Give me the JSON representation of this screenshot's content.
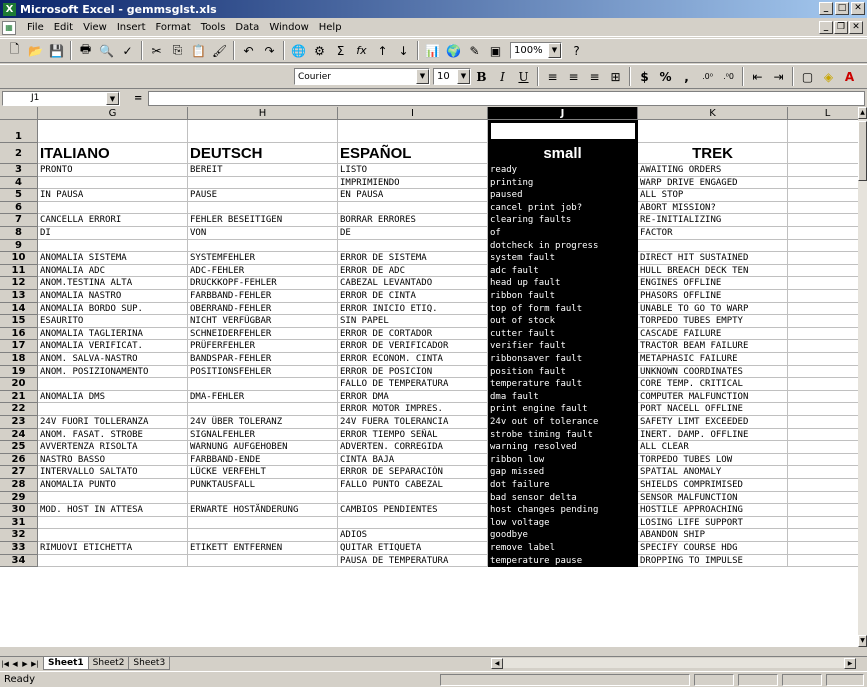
{
  "window": {
    "title": "Microsoft Excel - gemmsglst.xls",
    "app_icon": "excel-icon"
  },
  "menu": [
    "File",
    "Edit",
    "View",
    "Insert",
    "Format",
    "Tools",
    "Data",
    "Window",
    "Help"
  ],
  "toolbar": {
    "zoom": "100%",
    "font": "Courier",
    "font_size": "10",
    "bold": "B",
    "italic": "I",
    "underline": "U",
    "currency": "$",
    "percent": "%",
    "comma": ",",
    "sum": "Σ",
    "fx": "fx"
  },
  "formula_bar": {
    "name_box": "J1",
    "equals": "=",
    "value": ""
  },
  "columns": [
    {
      "letter": "G",
      "selected": false
    },
    {
      "letter": "H",
      "selected": false
    },
    {
      "letter": "I",
      "selected": false
    },
    {
      "letter": "J",
      "selected": true
    },
    {
      "letter": "K",
      "selected": false
    },
    {
      "letter": "L",
      "selected": false
    }
  ],
  "rows": [
    {
      "n": "1",
      "g": "",
      "h": "",
      "i": "",
      "j": "",
      "k": ""
    },
    {
      "n": "2",
      "g": "ITALIANO",
      "h": "DEUTSCH",
      "i": "ESPAÑOL",
      "j": "small",
      "k": "TREK"
    },
    {
      "n": "3",
      "g": "PRONTO",
      "h": "BEREIT",
      "i": "LISTO",
      "j": "ready",
      "k": "AWAITING ORDERS"
    },
    {
      "n": "4",
      "g": "",
      "h": "",
      "i": "IMPRIMIENDO",
      "j": "printing",
      "k": "WARP DRIVE ENGAGED"
    },
    {
      "n": "5",
      "g": "IN PAUSA",
      "h": "PAUSE",
      "i": "EN PAUSA",
      "j": "paused",
      "k": "ALL STOP"
    },
    {
      "n": "6",
      "g": "",
      "h": "",
      "i": "",
      "j": "cancel print job?",
      "k": "ABORT MISSION?"
    },
    {
      "n": "7",
      "g": "CANCELLA ERRORI",
      "h": "FEHLER BESEITIGEN",
      "i": "BORRAR ERRORES",
      "j": "clearing faults",
      "k": "RE-INITIALIZING"
    },
    {
      "n": "8",
      "g": "DI",
      "h": "VON",
      "i": "DE",
      "j": "of",
      "k": "FACTOR"
    },
    {
      "n": "9",
      "g": "",
      "h": "",
      "i": "",
      "j": "dotcheck in progress",
      "k": ""
    },
    {
      "n": "10",
      "g": "ANOMALIA SISTEMA",
      "h": "SYSTEMFEHLER",
      "i": "ERROR DE SISTEMA",
      "j": "system fault",
      "k": "DIRECT HIT SUSTAINED"
    },
    {
      "n": "11",
      "g": "ANOMALIA ADC",
      "h": "ADC-FEHLER",
      "i": "ERROR DE ADC",
      "j": "adc fault",
      "k": "HULL BREACH DECK TEN"
    },
    {
      "n": "12",
      "g": "ANOM.TESTINA ALTA",
      "h": "DRUCKKOPF-FEHLER",
      "i": "CABEZAL LEVANTADO",
      "j": "head up fault",
      "k": "ENGINES OFFLINE"
    },
    {
      "n": "13",
      "g": "ANOMALIA NASTRO",
      "h": "FARBBAND-FEHLER",
      "i": "ERROR DE CINTA",
      "j": "ribbon fault",
      "k": "PHASORS OFFLINE"
    },
    {
      "n": "14",
      "g": "ANOMALIA BORDO SUP.",
      "h": "OBERRAND-FEHLER",
      "i": "ERROR INICIO ETIQ.",
      "j": "top of form fault",
      "k": "UNABLE TO GO TO WARP"
    },
    {
      "n": "15",
      "g": "ESAURITO",
      "h": "NICHT VERFÜGBAR",
      "i": "SIN PAPEL",
      "j": "out of stock",
      "k": "TORPEDO TUBES EMPTY"
    },
    {
      "n": "16",
      "g": "ANOMALIA TAGLIERINA",
      "h": "SCHNEIDERFEHLER",
      "i": "ERROR DE CORTADOR",
      "j": "cutter fault",
      "k": "CASCADE FAILURE"
    },
    {
      "n": "17",
      "g": "ANOMALIA VERIFICAT.",
      "h": "PRÜFERFEHLER",
      "i": "ERROR DE VERIFICADOR",
      "j": "verifier fault",
      "k": "TRACTOR BEAM FAILURE"
    },
    {
      "n": "18",
      "g": "ANOM. SALVA-NASTRO",
      "h": "BANDSPAR-FEHLER",
      "i": "ERROR ECONOM. CINTA",
      "j": "ribbonsaver fault",
      "k": "METAPHASIC FAILURE"
    },
    {
      "n": "19",
      "g": "ANOM. POSIZIONAMENTO",
      "h": "POSITIONSFEHLER",
      "i": "ERROR DE POSICION",
      "j": "position fault",
      "k": "UNKNOWN COORDINATES"
    },
    {
      "n": "20",
      "g": "",
      "h": "",
      "i": "FALLO DE TEMPERATURA",
      "j": "temperature fault",
      "k": "CORE TEMP. CRITICAL"
    },
    {
      "n": "21",
      "g": "ANOMALIA DMS",
      "h": "DMA-FEHLER",
      "i": "ERROR DMA",
      "j": "dma fault",
      "k": "COMPUTER MALFUNCTION"
    },
    {
      "n": "22",
      "g": "",
      "h": "",
      "i": "ERROR MOTOR IMPRES.",
      "j": "print engine fault",
      "k": "PORT NACELL OFFLINE"
    },
    {
      "n": "23",
      "g": "24V FUORI TOLLERANZA",
      "h": "24V ÜBER TOLERANZ",
      "i": "24V FUERA TOLERANCIA",
      "j": "24v out of tolerance",
      "k": "SAFETY LIMT EXCEEDED"
    },
    {
      "n": "24",
      "g": "ANOM. FASAT. STROBE",
      "h": "SIGNALFEHLER",
      "i": "ERROR TIEMPO SEÑAL",
      "j": "strobe timing fault",
      "k": "INERT. DAMP. OFFLINE"
    },
    {
      "n": "25",
      "g": "AVVERTENZA RISOLTA",
      "h": "WARNUNG AUFGEHOBEN",
      "i": "ADVERTEN. CORREGIDA",
      "j": "warning resolved",
      "k": "ALL CLEAR"
    },
    {
      "n": "26",
      "g": "NASTRO BASSO",
      "h": "FARBBAND-ENDE",
      "i": "CINTA BAJA",
      "j": "ribbon low",
      "k": "TORPEDO TUBES LOW"
    },
    {
      "n": "27",
      "g": "INTERVALLO SALTATO",
      "h": "LÜCKE VERFEHLT",
      "i": "ERROR DE SEPARACIÓN",
      "j": "gap missed",
      "k": "SPATIAL ANOMALY"
    },
    {
      "n": "28",
      "g": "ANOMALIA PUNTO",
      "h": "PUNKTAUSFALL",
      "i": "FALLO PUNTO CABEZAL",
      "j": "dot failure",
      "k": "SHIELDS COMPRIMISED"
    },
    {
      "n": "29",
      "g": "",
      "h": "",
      "i": "",
      "j": "bad sensor delta",
      "k": "SENSOR MALFUNCTION"
    },
    {
      "n": "30",
      "g": "MOD. HOST IN ATTESA",
      "h": "ERWARTE HOSTÄNDERUNG",
      "i": "CAMBIOS PENDIENTES",
      "j": "host changes pending",
      "k": "HOSTILE APPROACHING"
    },
    {
      "n": "31",
      "g": "",
      "h": "",
      "i": "",
      "j": "low voltage",
      "k": "LOSING LIFE SUPPORT"
    },
    {
      "n": "32",
      "g": "",
      "h": "",
      "i": "ADIOS",
      "j": "goodbye",
      "k": "ABANDON SHIP"
    },
    {
      "n": "33",
      "g": "RIMUOVI ETICHETTA",
      "h": "ETIKETT ENTFERNEN",
      "i": "QUITAR ETIQUETA",
      "j": "remove label",
      "k": "SPECIFY COURSE HDG"
    },
    {
      "n": "34",
      "g": "",
      "h": "",
      "i": "PAUSA DE TEMPERATURA",
      "j": "temperature pause",
      "k": "DROPPING TO IMPULSE"
    }
  ],
  "sheets": [
    {
      "label": "Sheet1",
      "active": true
    },
    {
      "label": "Sheet2",
      "active": false
    },
    {
      "label": "Sheet3",
      "active": false
    }
  ],
  "status": "Ready"
}
